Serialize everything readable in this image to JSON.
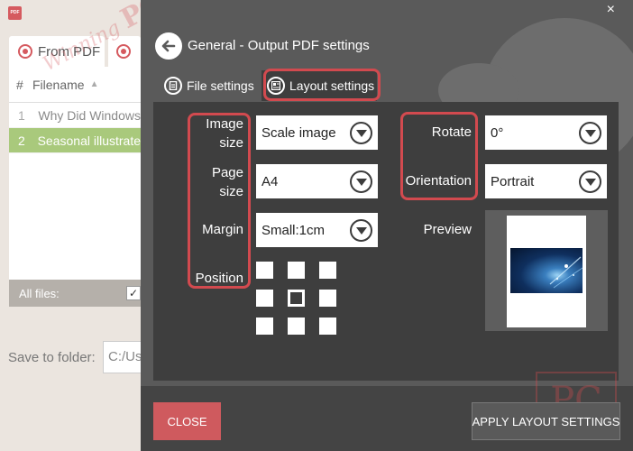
{
  "background": {
    "app_logo_text": "PDF",
    "tabs": [
      {
        "label": "From PDF"
      }
    ],
    "list": {
      "columns": {
        "number": "#",
        "filename": "Filename"
      },
      "rows": [
        {
          "num": "1",
          "name": "Why Did Windows"
        },
        {
          "num": "2",
          "name": "Seasonal illustrate"
        }
      ],
      "footer_label": "All files:"
    },
    "save_to_folder": {
      "label": "Save to folder:",
      "value": "C:/Us"
    },
    "watermark": {
      "prefix": "Winning",
      "brand": "PC"
    }
  },
  "modal": {
    "title": "General - Output PDF settings",
    "close_glyph": "×",
    "tabs": [
      {
        "label": "File settings",
        "active": false
      },
      {
        "label": "Layout settings",
        "active": true
      }
    ],
    "left": {
      "image_size": {
        "label": "Image size",
        "value": "Scale image"
      },
      "page_size": {
        "label": "Page size",
        "value": "A4"
      },
      "margin": {
        "label": "Margin",
        "value": "Small:1cm"
      },
      "position": {
        "label": "Position",
        "selected_index": 4
      }
    },
    "right": {
      "rotate": {
        "label": "Rotate",
        "value": "0°"
      },
      "orientation": {
        "label": "Orientation",
        "value": "Portrait"
      },
      "preview_label": "Preview"
    },
    "buttons": {
      "close": "CLOSE",
      "apply": "APPLY LAYOUT SETTINGS"
    },
    "watermark_text": "PC",
    "colors": {
      "accent": "#cf5a5e",
      "highlight": "#d24a4f",
      "panel": "#3e3e3e",
      "modal_bg": "#5a5a5a",
      "selected_row": "#a9c97c"
    }
  }
}
